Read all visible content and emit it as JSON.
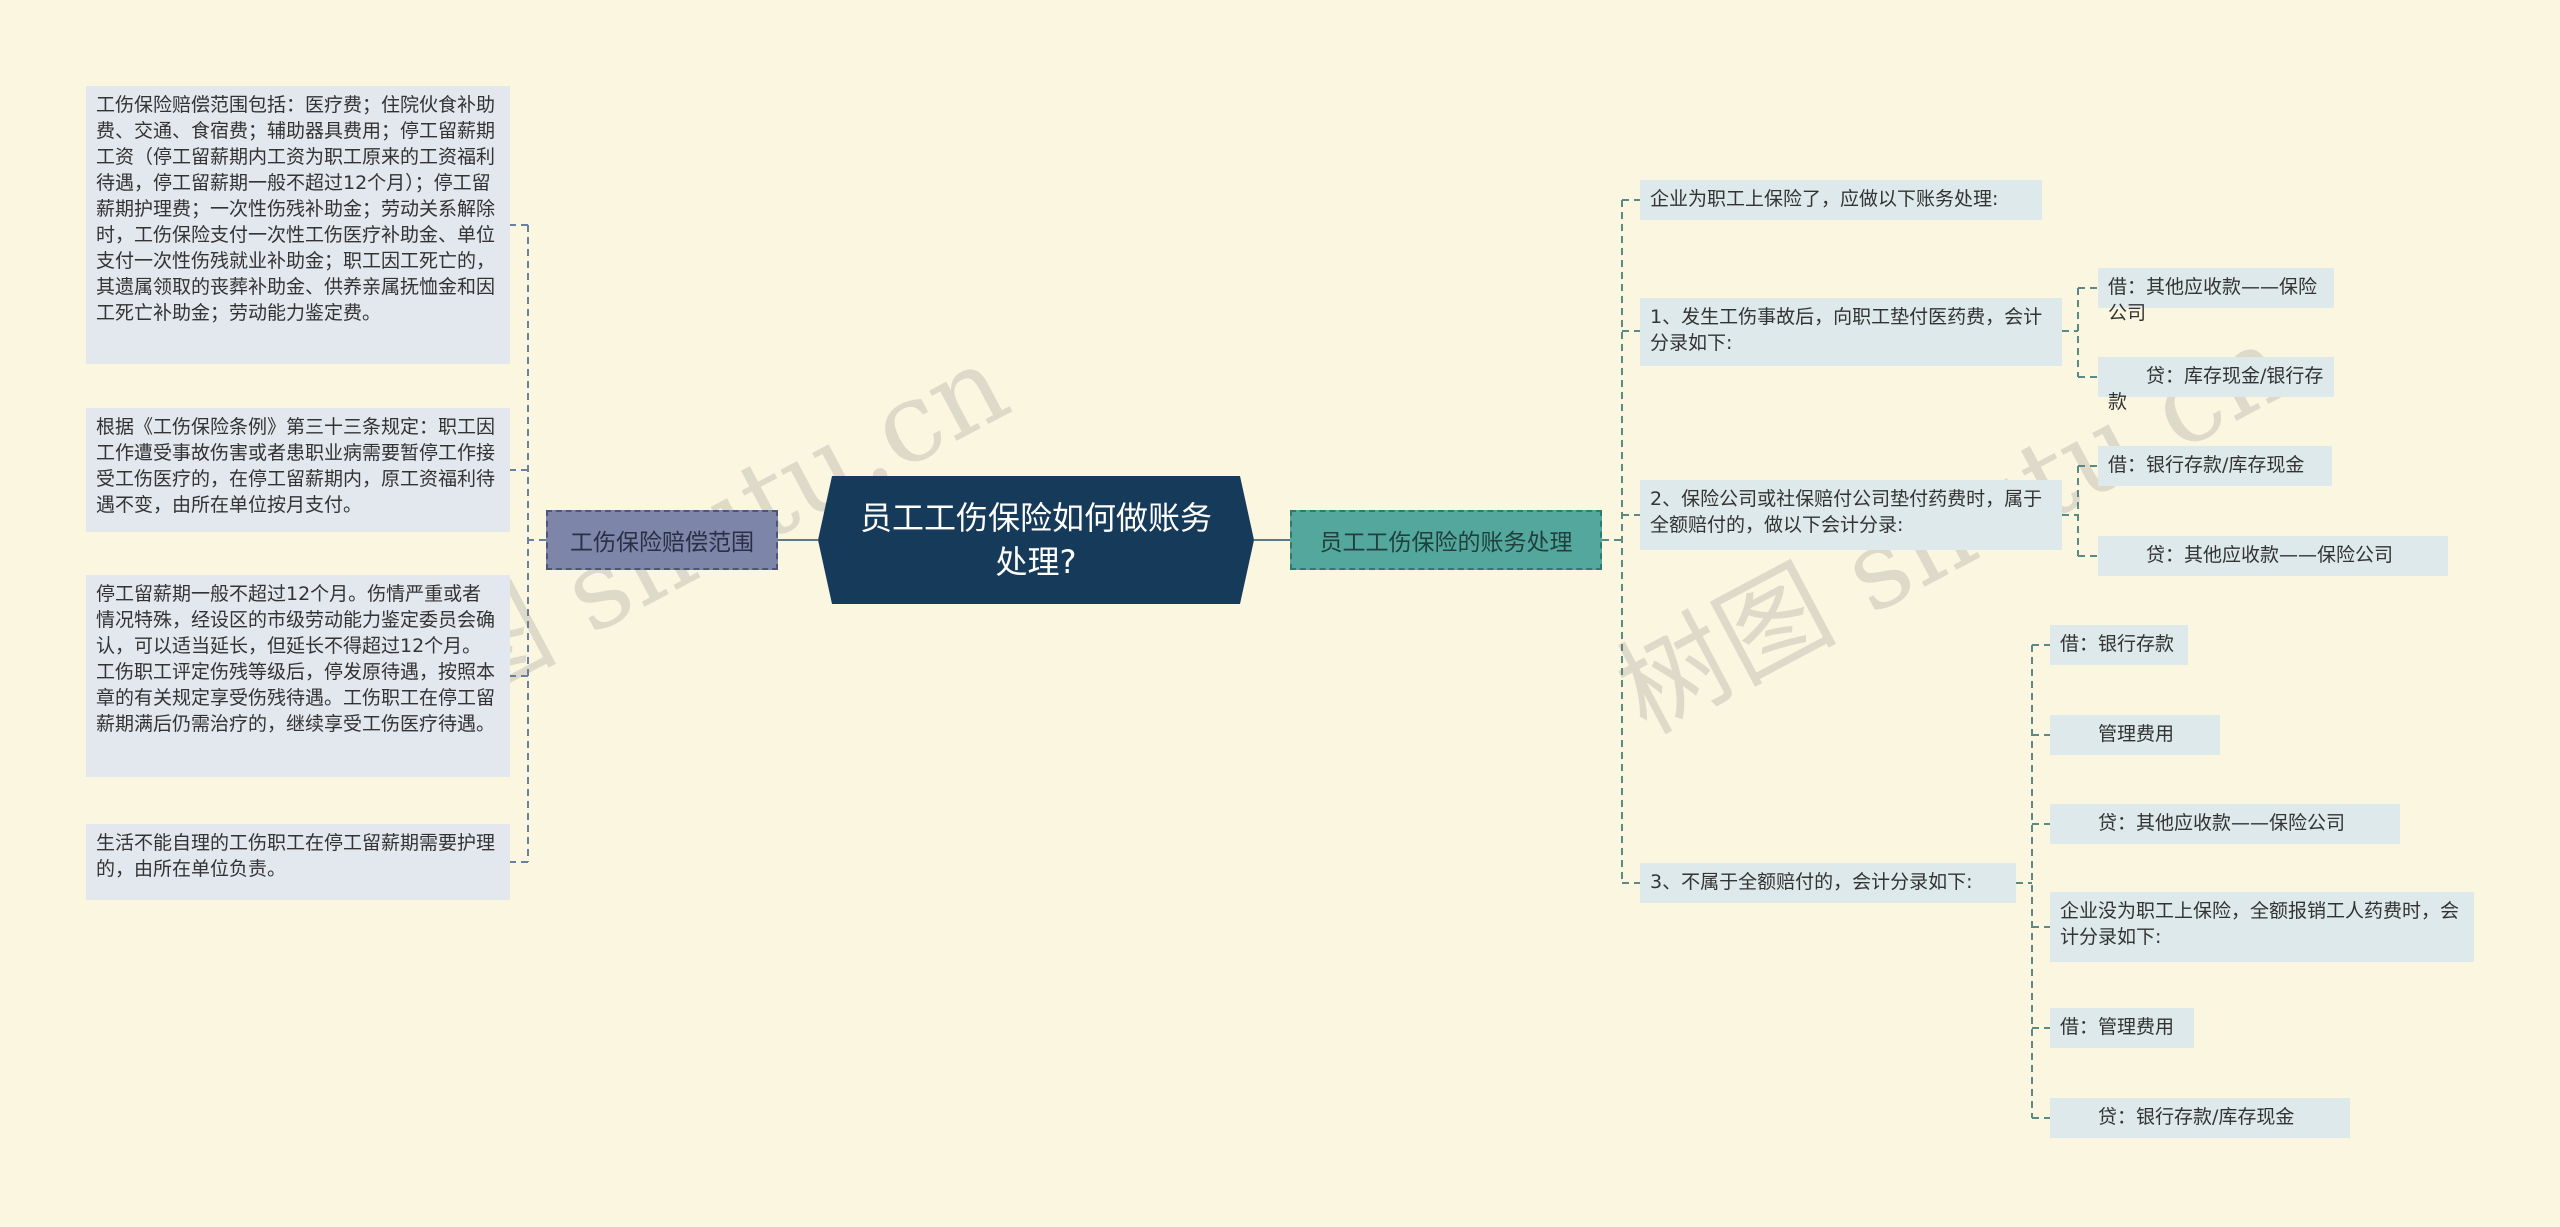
{
  "root": {
    "title": "员工工伤保险如何做账务处理?"
  },
  "left": {
    "label": "工伤保险赔偿范围",
    "items": [
      "工伤保险赔偿范围包括：医疗费；住院伙食补助费、交通、食宿费；辅助器具费用；停工留薪期工资（停工留薪期内工资为职工原来的工资福利待遇，停工留薪期一般不超过12个月）；停工留薪期护理费；一次性伤残补助金；劳动关系解除时，工伤保险支付一次性工伤医疗补助金、单位支付一次性伤残就业补助金；职工因工死亡的，其遗属领取的丧葬补助金、供养亲属抚恤金和因工死亡补助金；劳动能力鉴定费。",
      "根据《工伤保险条例》第三十三条规定：职工因工作遭受事故伤害或者患职业病需要暂停工作接受工伤医疗的，在停工留薪期内，原工资福利待遇不变，由所在单位按月支付。",
      "停工留薪期一般不超过12个月。伤情严重或者情况特殊，经设区的市级劳动能力鉴定委员会确认，可以适当延长，但延长不得超过12个月。工伤职工评定伤残等级后，停发原待遇，按照本章的有关规定享受伤残待遇。工伤职工在停工留薪期满后仍需治疗的，继续享受工伤医疗待遇。",
      "生活不能自理的工伤职工在停工留薪期需要护理的，由所在单位负责。"
    ]
  },
  "right": {
    "label": "员工工伤保险的账务处理",
    "sub": [
      {
        "text": "企业为职工上保险了，应做以下账务处理:",
        "children": []
      },
      {
        "text": "1、发生工伤事故后，向职工垫付医药费，会计分录如下:",
        "children": [
          "借：其他应收款——保险公司",
          "　　贷：库存现金/银行存款"
        ]
      },
      {
        "text": "2、保险公司或社保赔付公司垫付药费时，属于全额赔付的，做以下会计分录:",
        "children": [
          "借：银行存款/库存现金",
          "　　贷：其他应收款——保险公司"
        ]
      },
      {
        "text": "3、不属于全额赔付的，会计分录如下:",
        "children": [
          "借：银行存款",
          "　　管理费用",
          "　　贷：其他应收款——保险公司",
          "企业没为职工上保险，全额报销工人药费时，会计分录如下:",
          "借：管理费用",
          "　　贷：银行存款/库存现金"
        ]
      }
    ]
  },
  "watermark": [
    "树图 shutu.cn",
    "树图 shutu.cn"
  ],
  "colors": {
    "background": "#fbf6e0",
    "root": "#163b5a",
    "left_branch": "#7d86a8",
    "right_branch": "#53a79c"
  }
}
